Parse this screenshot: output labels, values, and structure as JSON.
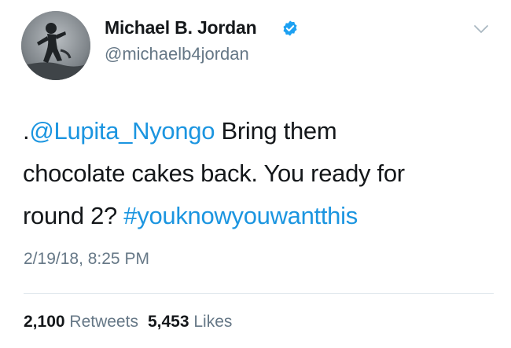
{
  "user": {
    "display_name": "Michael B. Jordan",
    "handle": "@michaelb4jordan",
    "verified": true
  },
  "tweet": {
    "prefix": ".",
    "mention": "@Lupita_Nyongo",
    "line1_rest": " Bring them",
    "line2": "chocolate cakes back. You ready for",
    "line3_start": "round 2? ",
    "hashtag": "#youknowyouwantthis",
    "timestamp": "2/19/18, 8:25 PM"
  },
  "stats": {
    "retweets_count": "2,100",
    "retweets_label": "Retweets",
    "likes_count": "5,453",
    "likes_label": "Likes"
  },
  "colors": {
    "link": "#1b95e0",
    "verified_badge": "#1da1f2",
    "secondary_text": "#657786",
    "primary_text": "#14171a"
  },
  "icons": {
    "verified": "verified-badge-icon",
    "menu": "chevron-down-icon"
  }
}
